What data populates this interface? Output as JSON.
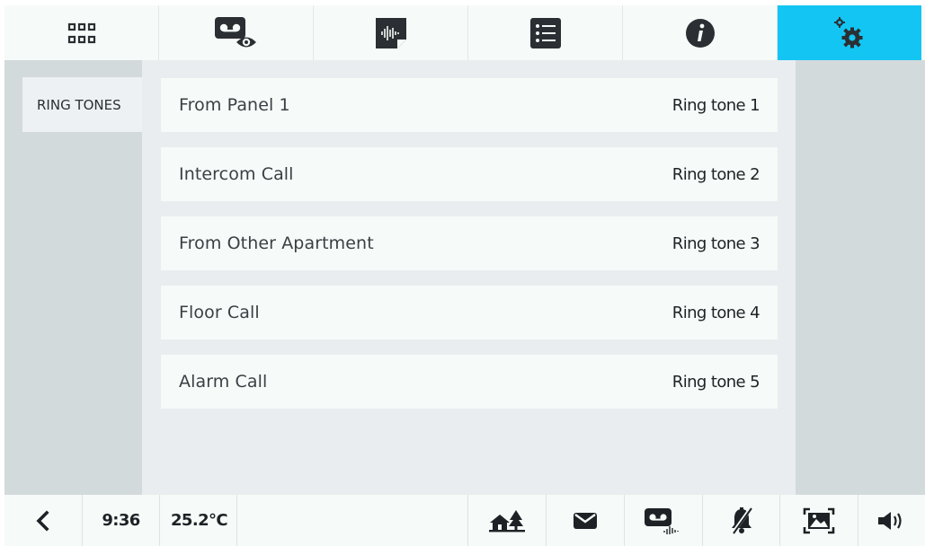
{
  "colors": {
    "accent": "#13c5f2",
    "background": "#e9edef",
    "panel": "#f6faf8",
    "sidebar": "#d3dadb",
    "icon": "#2b2f33"
  },
  "top_tabs": [
    {
      "icon": "apps-grid-icon",
      "active": false
    },
    {
      "icon": "voicemail-view-icon",
      "active": false
    },
    {
      "icon": "audio-note-icon",
      "active": false
    },
    {
      "icon": "list-icon",
      "active": false
    },
    {
      "icon": "info-icon",
      "active": false
    },
    {
      "icon": "settings-gears-icon",
      "active": true
    }
  ],
  "sidebar": {
    "items": [
      {
        "label": "RING TONES",
        "selected": true
      }
    ]
  },
  "ringtones": [
    {
      "label": "From Panel 1",
      "value": "Ring tone 1"
    },
    {
      "label": "Intercom Call",
      "value": "Ring tone 2"
    },
    {
      "label": "From Other Apartment",
      "value": "Ring tone 3"
    },
    {
      "label": "Floor Call",
      "value": "Ring tone 4"
    },
    {
      "label": "Alarm Call",
      "value": "Ring tone 5"
    }
  ],
  "status": {
    "time": "9:36",
    "temperature": "25.2°C"
  },
  "bottom_icons": [
    "back-chevron-icon",
    "home-tree-icon",
    "mail-icon",
    "voicemail-audio-icon",
    "bell-muted-icon",
    "picture-frame-icon",
    "speaker-icon"
  ]
}
